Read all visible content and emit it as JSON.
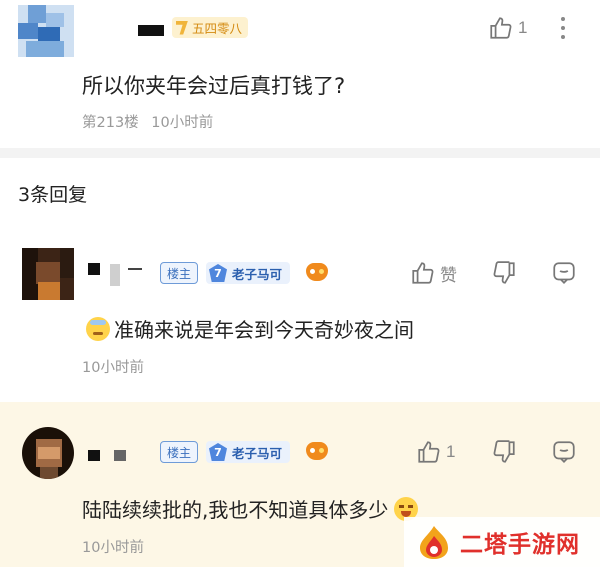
{
  "top_comment": {
    "user_badge": "五四零八",
    "like_count": "1",
    "text": "所以你夹年会过后真打钱了?",
    "floor": "第213楼",
    "time": "10小时前"
  },
  "reply_header": "3条回复",
  "replies": [
    {
      "owner_label": "楼主",
      "level": "7",
      "level_title": "老子马可",
      "like_label": "赞",
      "text": "准确来说是年会到今天奇妙夜之间",
      "time": "10小时前"
    },
    {
      "owner_label": "楼主",
      "level": "7",
      "level_title": "老子马可",
      "like_count": "1",
      "text": "陆陆续续批的,我也不知道具体多少",
      "time": "10小时前"
    }
  ],
  "watermark": "二塔手游网",
  "colors": {
    "accent": "#3a6fbd",
    "watermark": "#e0302b",
    "highlight": "#fdf7e6"
  }
}
